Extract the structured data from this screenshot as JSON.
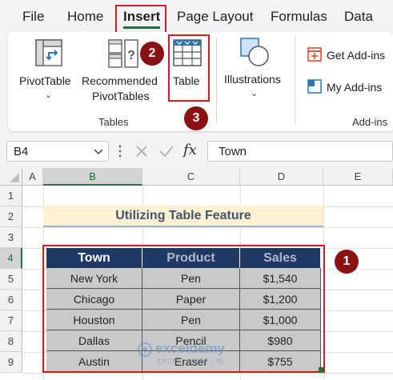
{
  "menu": {
    "tabs": [
      {
        "label": "File"
      },
      {
        "label": "Home"
      },
      {
        "label": "Insert"
      },
      {
        "label": "Page Layout"
      },
      {
        "label": "Formulas"
      },
      {
        "label": "Data"
      }
    ]
  },
  "ribbon": {
    "pivottable_label": "PivotTable",
    "recommended_line1": "Recommended",
    "recommended_line2": "PivotTables",
    "table_label": "Table",
    "tables_group": "Tables",
    "illustrations_label": "Illustrations",
    "get_addins_label": "Get Add-ins",
    "my_addins_label": "My Add-ins",
    "addins_group": "Add-ins"
  },
  "markers": {
    "one": "1",
    "two": "2",
    "three": "3"
  },
  "formula_bar": {
    "name_box": "B4",
    "fx": "fx",
    "content": "Town"
  },
  "sheet": {
    "columns": [
      "A",
      "B",
      "C",
      "D",
      "E"
    ],
    "rows": [
      "1",
      "2",
      "3",
      "4",
      "5",
      "6",
      "7",
      "8",
      "9"
    ],
    "title": "Utilizing Table Feature",
    "headers": [
      "Town",
      "Product",
      "Sales"
    ],
    "data": [
      [
        "New York",
        "Pen",
        "$1,540"
      ],
      [
        "Chicago",
        "Paper",
        "$1,200"
      ],
      [
        "Houston",
        "Pen",
        "$1,000"
      ],
      [
        "Dallas",
        "Pencil",
        "$980"
      ],
      [
        "Austin",
        "Eraser",
        "$755"
      ]
    ]
  },
  "watermark": {
    "name": "exceldemy",
    "tagline": "EXCEL · DATA · BI"
  },
  "colors": {
    "accent": "#217346",
    "marker": "#8b1212",
    "highlight": "#d71920",
    "table_header": "#203864"
  }
}
